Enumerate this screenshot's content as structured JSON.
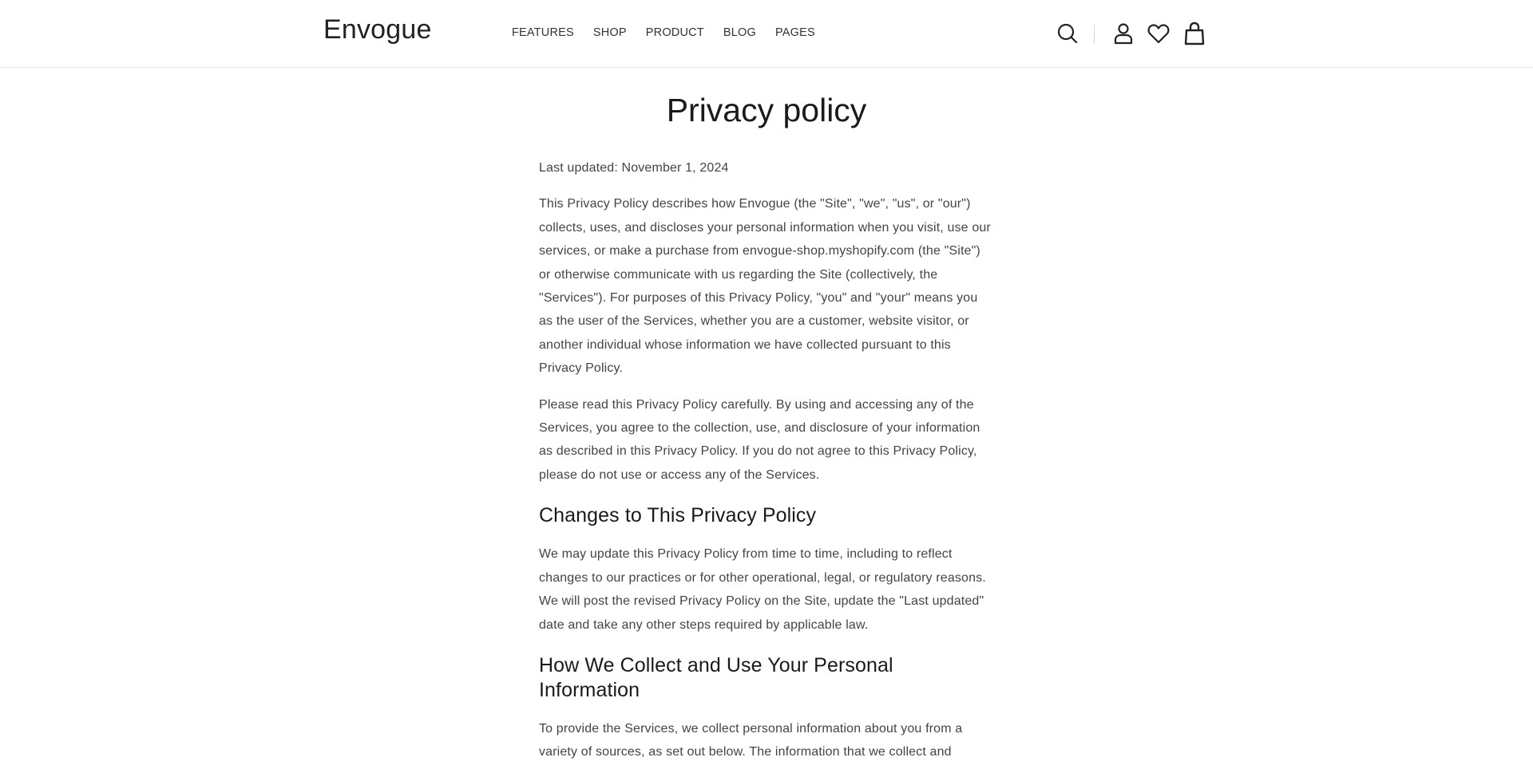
{
  "header": {
    "logo": "Envogue",
    "nav": [
      "FEATURES",
      "SHOP",
      "PRODUCT",
      "BLOG",
      "PAGES"
    ],
    "icons": [
      "search-icon",
      "account-icon",
      "wishlist-icon",
      "cart-icon"
    ]
  },
  "page": {
    "title": "Privacy policy",
    "last_updated": "Last updated: November 1, 2024",
    "paragraphs": [
      "This Privacy Policy describes how Envogue (the \"Site\", \"we\", \"us\", or \"our\") collects, uses, and discloses your personal information when you visit, use our services, or make a purchase from envogue-shop.myshopify.com (the \"Site\") or otherwise communicate with us regarding the Site (collectively, the \"Services\"). For purposes of this Privacy Policy, \"you\" and \"your\" means you as the user of the Services, whether you are a customer, website visitor, or another individual whose information we have collected pursuant to this Privacy Policy.",
      "Please read this Privacy Policy carefully. By using and accessing any of the Services, you agree to the collection, use, and disclosure of your information as described in this Privacy Policy. If you do not agree to this Privacy Policy, please do not use or access any of the Services."
    ],
    "sections": [
      {
        "heading": "Changes to This Privacy Policy",
        "text": "We may update this Privacy Policy from time to time, including to reflect changes to our practices or for other operational, legal, or regulatory reasons. We will post the revised Privacy Policy on the Site, update the \"Last updated\" date and take any other steps required by applicable law."
      },
      {
        "heading": "How We Collect and Use Your Personal Information",
        "text": "To provide the Services, we collect personal information about you from a variety of sources, as set out below. The information that we collect and"
      }
    ]
  }
}
